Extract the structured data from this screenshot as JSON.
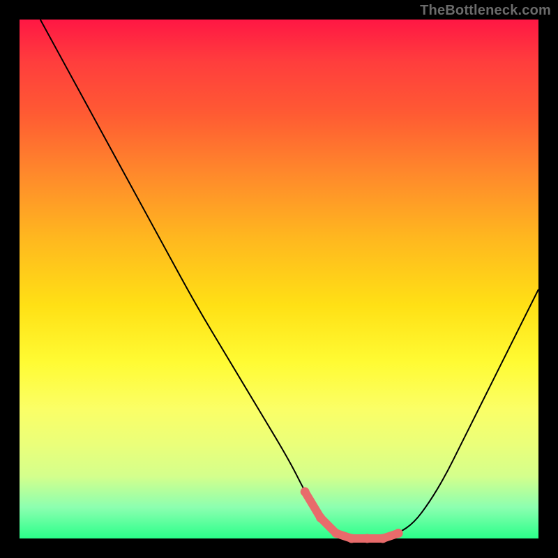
{
  "watermark": "TheBottleneck.com",
  "colors": {
    "background": "#000000",
    "curve": "#000000",
    "accent": "#e86b6b",
    "gradient_stops": [
      "#ff1744",
      "#ff3d3d",
      "#ff5a33",
      "#ff8a2b",
      "#ffb71f",
      "#ffe015",
      "#fffb33",
      "#fbff66",
      "#eaff7a",
      "#d4ff8c",
      "#8cffb0",
      "#2aff8a"
    ]
  },
  "chart_data": {
    "type": "line",
    "title": "",
    "xlabel": "",
    "ylabel": "",
    "xlim": [
      0,
      100
    ],
    "ylim": [
      0,
      100
    ],
    "grid": false,
    "legend": false,
    "series": [
      {
        "name": "curve",
        "x": [
          4,
          10,
          16,
          22,
          28,
          34,
          40,
          46,
          52,
          55,
          58,
          61,
          64,
          67,
          70,
          73,
          76,
          79,
          82,
          85,
          88,
          91,
          94,
          97,
          100
        ],
        "y": [
          100,
          89,
          78,
          67,
          56,
          45,
          35,
          25,
          15,
          9,
          4,
          1,
          0,
          0,
          0,
          1,
          3,
          7,
          12,
          18,
          24,
          30,
          36,
          42,
          48
        ]
      }
    ],
    "accent_marker": {
      "note": "thick coral segment along the curve near its minimum",
      "x_range": [
        55,
        73
      ],
      "y_approx": 0
    }
  }
}
